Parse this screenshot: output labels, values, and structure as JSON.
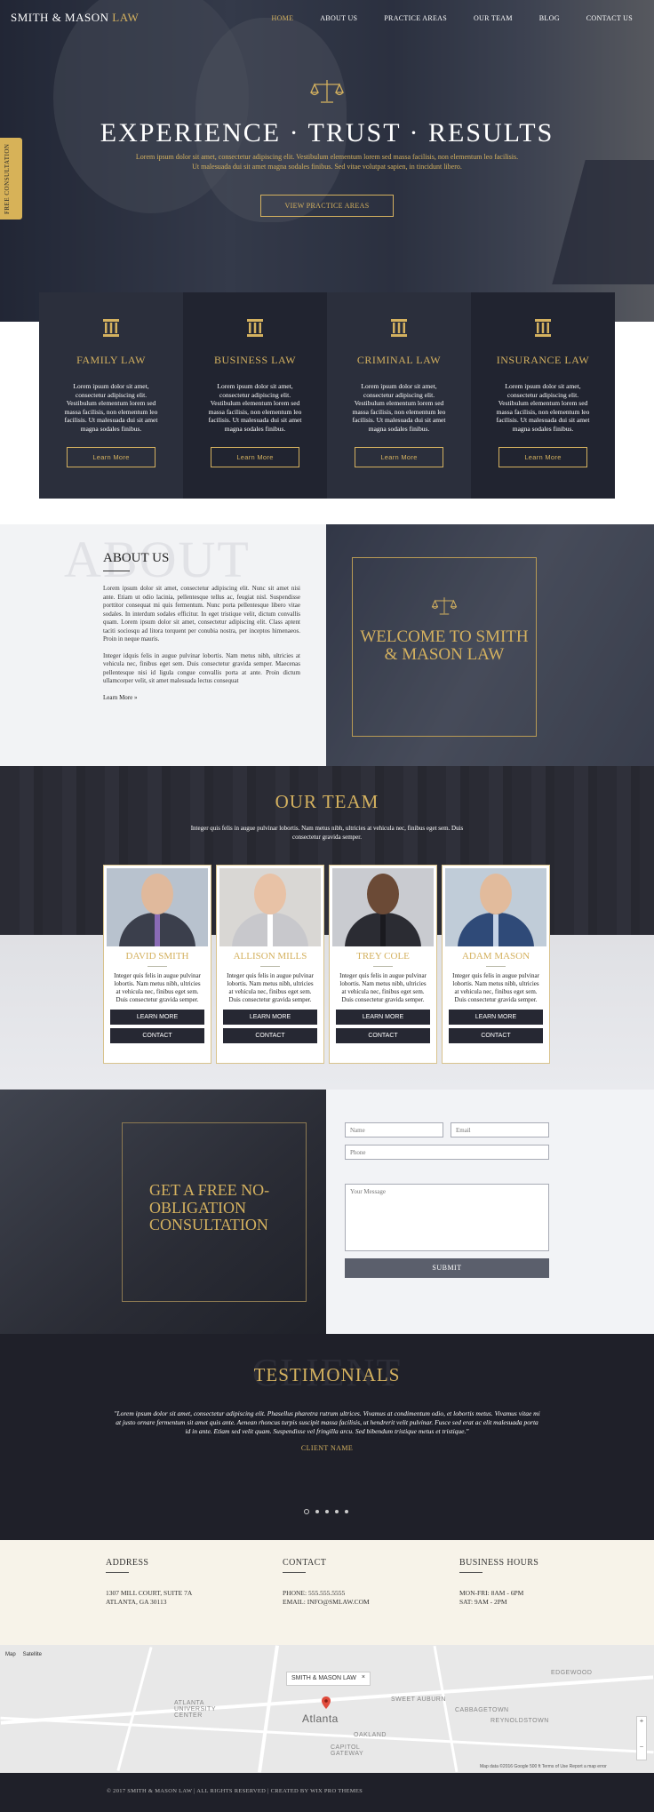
{
  "nav": {
    "logo_part1": "SMITH & MASON",
    "logo_part2": "LAW",
    "items": [
      "HOME",
      "ABOUT US",
      "PRACTICE AREAS",
      "OUR TEAM",
      "BLOG",
      "CONTACT US"
    ],
    "active": "HOME"
  },
  "hero": {
    "title": "EXPERIENCE · TRUST · RESULTS",
    "text": "Lorem ipsum dolor sit amet, consectetur adipiscing elit. Vestibulum elementum lorem sed massa facilisis, non elementum leo facilisis. Ut malesuada dui sit amet magna sodales finibus. Sed vitae volutpat sapien, in tincidunt libero.",
    "button": "VIEW PRACTICE AREAS",
    "side_tab": "FREE CONSULTATION"
  },
  "practice": [
    {
      "title": "FAMILY LAW",
      "text": "Lorem ipsum dolor sit amet, consectetur adipiscing elit. Vestibulum elementum lorem sed massa facilisis, non elementum leo facilisis. Ut malesuada dui sit amet magna sodales finibus.",
      "button": "Learn More"
    },
    {
      "title": "BUSINESS LAW",
      "text": "Lorem ipsum dolor sit amet, consectetur adipiscing elit. Vestibulum elementum lorem sed massa facilisis, non elementum leo facilisis. Ut malesuada dui sit amet magna sodales finibus.",
      "button": "Learn More"
    },
    {
      "title": "CRIMINAL LAW",
      "text": "Lorem ipsum dolor sit amet, consectetur adipiscing elit. Vestibulum elementum lorem sed massa facilisis, non elementum leo facilisis. Ut malesuada dui sit amet magna sodales finibus.",
      "button": "Learn More"
    },
    {
      "title": "INSURANCE LAW",
      "text": "Lorem ipsum dolor sit amet, consectetur adipiscing elit. Vestibulum elementum lorem sed massa facilisis, non elementum leo facilisis. Ut malesuada dui sit amet magna sodales finibus.",
      "button": "Learn More"
    }
  ],
  "about": {
    "bg_word": "ABOUT",
    "title": "ABOUT US",
    "para1": "Lorem ipsum dolor sit amet, consectetur adipiscing elit. Nunc sit amet nisi ante. Etiam ut odio lacinia, pellentesque tellus ac, feugiat nisl. Suspendisse porttitor consequat mi quis fermentum. Nunc porta pellentesque libero vitae sodales. In interdum sodales efficitur. In eget tristique velit, dictum convallis quam. Lorem ipsum dolor sit amet, consectetur adipiscing elit. Class aptent taciti sociosqu ad litora torquent per conubia nostra, per inceptos himenaeos. Proin in neque mauris.",
    "para2": "Integer idquis felis in augue pulvinar lobortis. Nam metus nibh, ultricies at vehicula nec, finibus eget sem. Duis consectetur gravida semper. Maecenas pellentesque nisi id ligula congue convallis porta at ante. Proin dictum ullamcorper velit, sit amet malesuada lectus consequat",
    "link": "Learn More »",
    "welcome": "WELCOME TO SMITH & MASON LAW"
  },
  "team": {
    "bg_word": "TEAM",
    "title": "OUR TEAM",
    "subtitle": "Integer quis felis in augue pulvinar lobortis. Nam metus nibh, ultricies at vehicula nec, finibus eget sem. Duis consectetur gravida semper.",
    "members": [
      {
        "name": "DAVID SMITH",
        "text": "Integer quis felis in augue pulvinar lobortis. Nam metus nibh, ultricies at vehicula nec, finibus eget sem. Duis consectetur gravida semper.",
        "btn1": "LEARN MORE",
        "btn2": "CONTACT",
        "skin": "#e0b99c",
        "suit": "#3b3f4c",
        "tie": "#8a6bb5",
        "bg": "#b8c2ce"
      },
      {
        "name": "ALLISON MILLS",
        "text": "Integer quis felis in augue pulvinar lobortis. Nam metus nibh, ultricies at vehicula nec, finibus eget sem. Duis consectetur gravida semper.",
        "btn1": "LEARN MORE",
        "btn2": "CONTACT",
        "skin": "#e8c2a6",
        "suit": "#c8c8cc",
        "tie": "#ffffff",
        "bg": "#d9d7d4"
      },
      {
        "name": "TREY COLE",
        "text": "Integer quis felis in augue pulvinar lobortis. Nam metus nibh, ultricies at vehicula nec, finibus eget sem. Duis consectetur gravida semper.",
        "btn1": "LEARN MORE",
        "btn2": "CONTACT",
        "skin": "#6b4a36",
        "suit": "#2b2c33",
        "tie": "#1a1a1f",
        "bg": "#c9cbd0"
      },
      {
        "name": "ADAM MASON",
        "text": "Integer quis felis in augue pulvinar lobortis. Nam metus nibh, ultricies at vehicula nec, finibus eget sem. Duis consectetur gravida semper.",
        "btn1": "LEARN MORE",
        "btn2": "CONTACT",
        "skin": "#e2bb9c",
        "suit": "#2f4a78",
        "tie": "#c4d2e6",
        "bg": "#c0ccd8"
      }
    ]
  },
  "consult": {
    "title": "GET A FREE NO-OBLIGATION CONSULTATION",
    "name_placeholder": "Name",
    "email_placeholder": "Email",
    "phone_placeholder": "Phone",
    "message_placeholder": "Your Message",
    "submit": "SUBMIT"
  },
  "testimonials": {
    "bg_word": "CLIENT",
    "title": "TESTIMONIALS",
    "quote": "\"Lorem ipsum dolor sit amet, consectetur adipiscing elit. Phasellus pharetra rutrum ultrices. Vivamus at condimentum odio, et lobortis metus. Vivamus vitae mi at justo ornare fermentum sit amet quis ante. Aenean rhoncus turpis suscipit massa facilisis, ut hendrerit velit pulvinar. Fusce sed erat ac elit malesuada porta id in ante. Etiam sed velit quam. Suspendisse vel fringilla arcu. Sed bibendum tristique metus et tristique.\"",
    "client": "CLIENT NAME",
    "slides": 5,
    "active_slide": 1
  },
  "info": {
    "address_title": "ADDRESS",
    "address_line1": "1307 MILL COURT, SUITE 7A",
    "address_line2": "ATLANTA, GA 30113",
    "contact_title": "CONTACT",
    "phone": "PHONE: 555.555.5555",
    "email": "EMAIL: INFO@SMLAW.COM",
    "hours_title": "BUSINESS HOURS",
    "hours1": "MON-FRI: 8AM - 6PM",
    "hours2": "SAT: 9AM - 2PM"
  },
  "map": {
    "tab_map": "Map",
    "tab_satellite": "Satellite",
    "bubble": "SMITH & MASON LAW",
    "city": "Atlanta",
    "labels": [
      "ATLANTA UNIVERSITY CENTER",
      "OAKLAND",
      "CAPITOL GATEWAY",
      "CABBAGETOWN",
      "REYNOLDSTOWN",
      "EDGEWOOD",
      "SWEET AUBURN"
    ],
    "footer": "Map data ©2016 Google   500 ft   Terms of Use   Report a map error"
  },
  "footer": {
    "text": "© 2017 SMITH & MASON LAW  |  ALL RIGHTS RESERVED  |  CREATED BY WIX PRO THEMES"
  },
  "colors": {
    "gold": "#d4b15f",
    "navy": "#212430",
    "cream": "#f7f3e9"
  }
}
